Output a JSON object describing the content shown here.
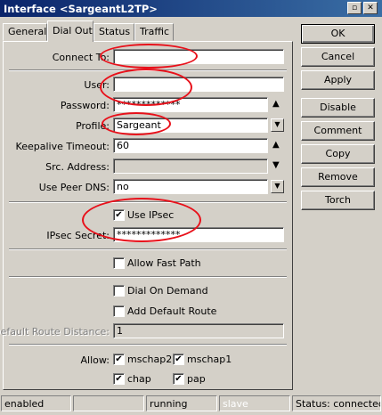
{
  "window": {
    "title": "Interface <SargeantL2TP>"
  },
  "tabs": [
    {
      "label": "General"
    },
    {
      "label": "Dial Out"
    },
    {
      "label": "Status"
    },
    {
      "label": "Traffic"
    }
  ],
  "form": {
    "connect_to_label": "Connect To:",
    "connect_to_value": "",
    "user_label": "User:",
    "user_value": "",
    "password_label": "Password:",
    "password_value": "*************",
    "profile_label": "Profile:",
    "profile_value": "Sargeant",
    "keepalive_label": "Keepalive Timeout:",
    "keepalive_value": "60",
    "src_address_label": "Src. Address:",
    "src_address_value": "",
    "use_peer_dns_label": "Use Peer DNS:",
    "use_peer_dns_value": "no",
    "use_ipsec_label": "Use IPsec",
    "use_ipsec_checked": true,
    "ipsec_secret_label": "IPsec Secret:",
    "ipsec_secret_value": "*************",
    "allow_fast_path_label": "Allow Fast Path",
    "dial_on_demand_label": "Dial On Demand",
    "add_default_route_label": "Add Default Route",
    "default_route_distance_label": "Default Route Distance:",
    "default_route_distance_value": "1",
    "allow_label": "Allow:",
    "allow_options": [
      {
        "label": "mschap2",
        "checked": true
      },
      {
        "label": "mschap1",
        "checked": true
      },
      {
        "label": "chap",
        "checked": true
      },
      {
        "label": "pap",
        "checked": true
      }
    ]
  },
  "buttons": {
    "ok": "OK",
    "cancel": "Cancel",
    "apply": "Apply",
    "disable": "Disable",
    "comment": "Comment",
    "copy": "Copy",
    "remove": "Remove",
    "torch": "Torch"
  },
  "status_bar": {
    "state": "enabled",
    "running": "running",
    "slave": "slave",
    "status": "Status: connected"
  },
  "icons": {
    "check_glyph": "✔",
    "dropdown_glyph": "▼",
    "up_glyph": "▲",
    "down_glyph": "▼",
    "minimize_glyph": "▫",
    "close_glyph": "✕"
  },
  "colors": {
    "annotation_red": "#e8101a",
    "title_bar": "#0a246a"
  }
}
